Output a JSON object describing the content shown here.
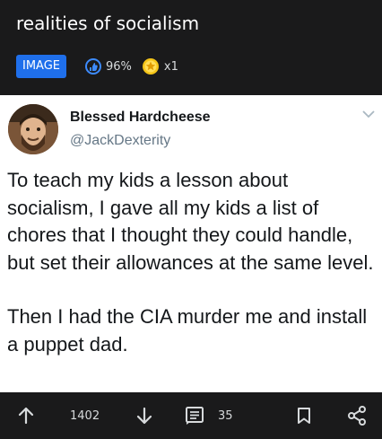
{
  "post": {
    "title": "realities of socialism",
    "flair": "IMAGE",
    "upvote_ratio": "96%",
    "award_count": "x1"
  },
  "tweet": {
    "display_name": "Blessed Hardcheese",
    "handle": "@JackDexterity",
    "paragraph1": "To teach my kids a lesson about socialism, I gave all my kids a list of chores that I thought they could handle, but set their allowances at the same level.",
    "paragraph2": "Then I had the CIA murder me and install a puppet dad."
  },
  "actions": {
    "score": "1402",
    "comment_count": "35"
  },
  "icons": [
    "upvote-icon",
    "downvote-icon",
    "comment-icon",
    "bookmark-icon",
    "share-icon",
    "chevron-down-icon",
    "thumb-icon",
    "award-icon"
  ],
  "colors": {
    "background": "#1a1a1b",
    "flair": "#1f6feb",
    "ratio_icon": "#3d8bfd",
    "tweet_bg": "#ffffff"
  }
}
